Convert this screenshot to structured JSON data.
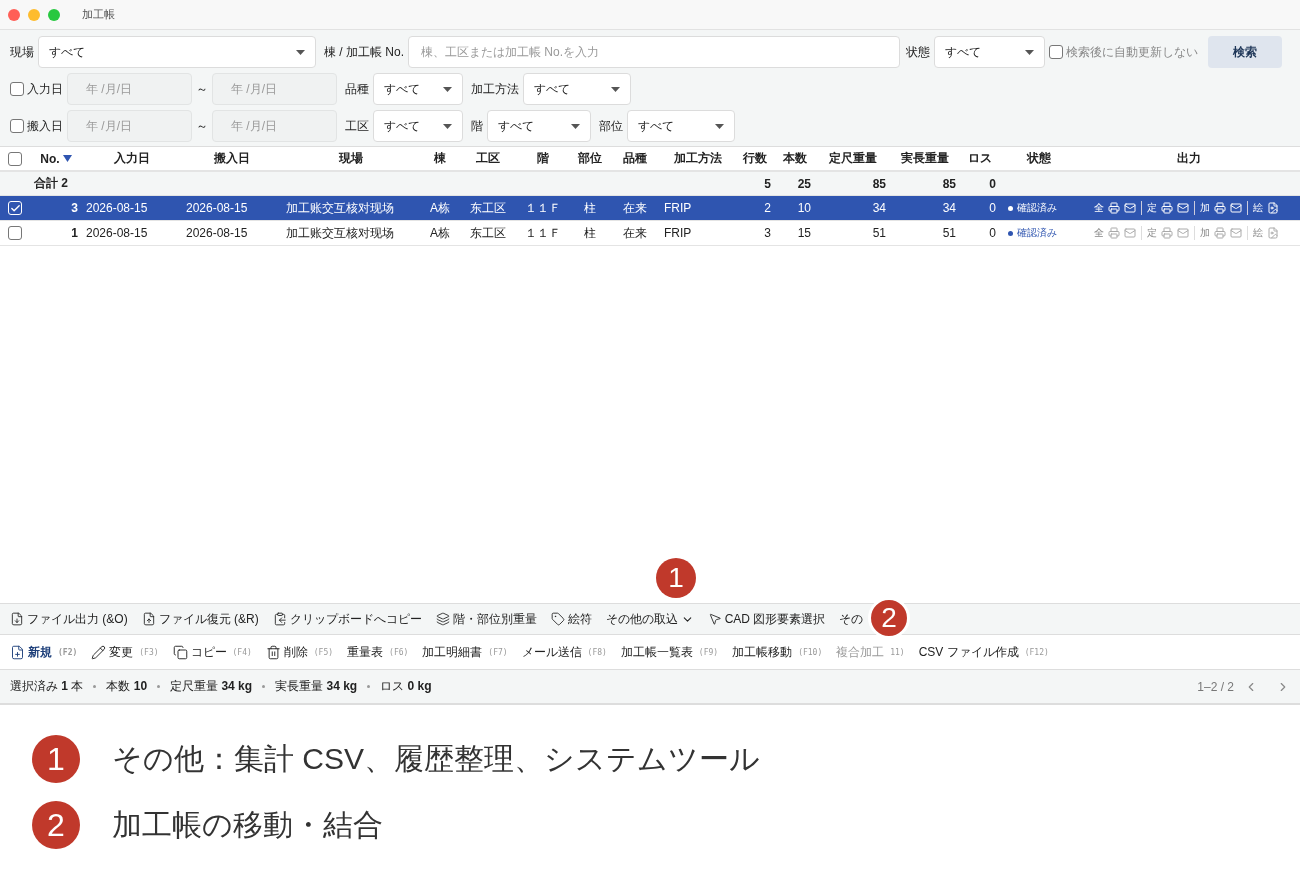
{
  "window": {
    "title": "加工帳"
  },
  "filters": {
    "site": {
      "label": "現場",
      "value": "すべて"
    },
    "search": {
      "label": "棟 / 加工帳 No.",
      "placeholder": "棟、工区または加工帳 No.を入力"
    },
    "status": {
      "label": "状態",
      "value": "すべて"
    },
    "auto_refresh": {
      "label": "検索後に自動更新しない",
      "checked": false
    },
    "search_button": "検索",
    "rows": [
      {
        "date_label": "入力日",
        "checked": false,
        "from": "年 /月/日",
        "sep": "～",
        "to": "年 /月/日",
        "selects": [
          {
            "label": "品種",
            "value": "すべて"
          },
          {
            "label": "加工方法",
            "value": "すべて"
          }
        ]
      },
      {
        "date_label": "搬入日",
        "checked": false,
        "from": "年 /月/日",
        "sep": "～",
        "to": "年 /月/日",
        "selects": [
          {
            "label": "工区",
            "value": "すべて"
          },
          {
            "label": "階",
            "value": "すべて"
          },
          {
            "label": "部位",
            "value": "すべて"
          }
        ]
      }
    ]
  },
  "table": {
    "all_checked": false,
    "columns": [
      {
        "label": "No.",
        "sorted": true
      },
      {
        "label": "入力日",
        "sorted": false
      },
      {
        "label": "搬入日",
        "sorted": false
      },
      {
        "label": "現場",
        "sorted": false
      },
      {
        "label": "棟",
        "sorted": false
      },
      {
        "label": "工区",
        "sorted": false
      },
      {
        "label": "階",
        "sorted": false
      },
      {
        "label": "部位",
        "sorted": false
      },
      {
        "label": "品種",
        "sorted": false
      },
      {
        "label": "加工方法",
        "sorted": false
      },
      {
        "label": "行数",
        "sorted": false
      },
      {
        "label": "本数",
        "sorted": false
      },
      {
        "label": "定尺重量",
        "sorted": false
      },
      {
        "label": "実長重量",
        "sorted": false
      },
      {
        "label": "ロス",
        "sorted": false
      },
      {
        "label": "状態",
        "sorted": false
      },
      {
        "label": "出力",
        "sorted": false
      }
    ],
    "total": {
      "label": "合計 2",
      "lines": "5",
      "pieces": "25",
      "std_weight": "85",
      "real_weight": "85",
      "loss": "0"
    },
    "rows": [
      {
        "selected": true,
        "checked": true,
        "cells": [
          "3",
          "2026-08-15",
          "2026-08-15",
          "加工账交互核对现场",
          "A栋",
          "东工区",
          "１１Ｆ",
          "柱",
          "在来",
          "FRIP",
          "2",
          "10",
          "34",
          "34",
          "0"
        ],
        "status": "確認済み",
        "outputs": [
          "全",
          "定",
          "加",
          "絵"
        ]
      },
      {
        "selected": false,
        "checked": false,
        "cells": [
          "1",
          "2026-08-15",
          "2026-08-15",
          "加工账交互核对现场",
          "A栋",
          "东工区",
          "１１Ｆ",
          "柱",
          "在来",
          "FRIP",
          "3",
          "15",
          "51",
          "51",
          "0"
        ],
        "status": "確認済み",
        "outputs": [
          "全",
          "定",
          "加",
          "絵"
        ]
      }
    ]
  },
  "toolbar": [
    {
      "label": "ファイル出力 (&O)"
    },
    {
      "label": "ファイル復元 (&R)"
    },
    {
      "label": "クリップボードへコピー"
    },
    {
      "label": "階・部位別重量"
    },
    {
      "label": "絵符"
    },
    {
      "label": "その他の取込"
    },
    {
      "label": "CAD 図形要素選択"
    },
    {
      "label": "その"
    }
  ],
  "actions": [
    {
      "label": "新規",
      "key": "(F2)",
      "disabled": false
    },
    {
      "label": "変更",
      "key": "(F3)",
      "disabled": false
    },
    {
      "label": "コピー",
      "key": "(F4)",
      "disabled": false
    },
    {
      "label": "削除",
      "key": "(F5)",
      "disabled": false
    },
    {
      "label": "重量表",
      "key": "(F6)",
      "disabled": false
    },
    {
      "label": "加工明細書",
      "key": "(F7)",
      "disabled": false
    },
    {
      "label": "メール送信",
      "key": "(F8)",
      "disabled": false
    },
    {
      "label": "加工帳一覧表",
      "key": "(F9)",
      "disabled": false
    },
    {
      "label": "加工帳移動",
      "key": "(F10)",
      "disabled": false
    },
    {
      "label": "複合加工",
      "key": "11)",
      "disabled": true
    },
    {
      "label": "CSV ファイル作成",
      "key": "(F12)",
      "disabled": false
    }
  ],
  "status_bar": {
    "items": [
      "選択済み **1** 本",
      "本数 **10**",
      "定尺重量 **34 kg**",
      "実長重量 **34 kg**",
      "ロス **0 kg**"
    ],
    "pagination": "1–2 / 2"
  },
  "callouts": [
    "1",
    "2"
  ],
  "annotations": [
    {
      "number": "1",
      "text": "その他：集計 CSV、履歴整理、システムツール"
    },
    {
      "number": "2",
      "text": "加工帳の移動・結合"
    }
  ]
}
